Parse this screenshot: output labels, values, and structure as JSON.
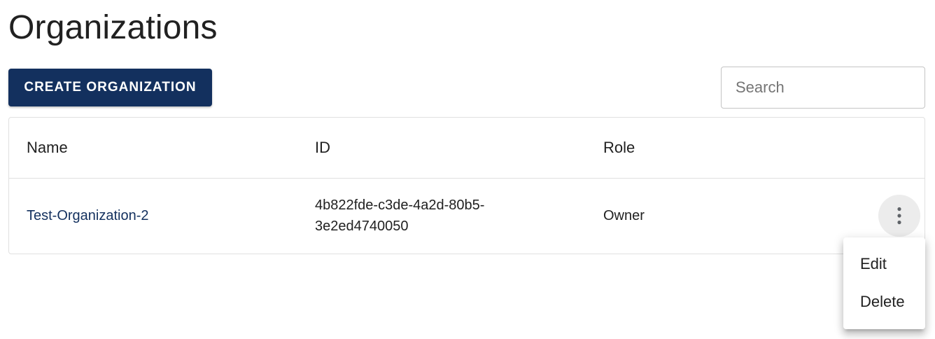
{
  "page": {
    "title": "Organizations"
  },
  "toolbar": {
    "create_label": "CREATE ORGANIZATION",
    "search_placeholder": "Search",
    "search_value": ""
  },
  "table": {
    "columns": [
      "Name",
      "ID",
      "Role"
    ],
    "rows": [
      {
        "name": "Test-Organization-2",
        "id_line1": "4b822fde-c3de-4a2d-80b5-",
        "id_line2": "3e2ed4740050",
        "role": "Owner"
      }
    ]
  },
  "row_menu": {
    "trigger_icon": "more-vert-icon",
    "items": [
      "Edit",
      "Delete"
    ]
  },
  "colors": {
    "primary": "#13305e",
    "link": "#13305e",
    "border": "#e0e0e0"
  }
}
